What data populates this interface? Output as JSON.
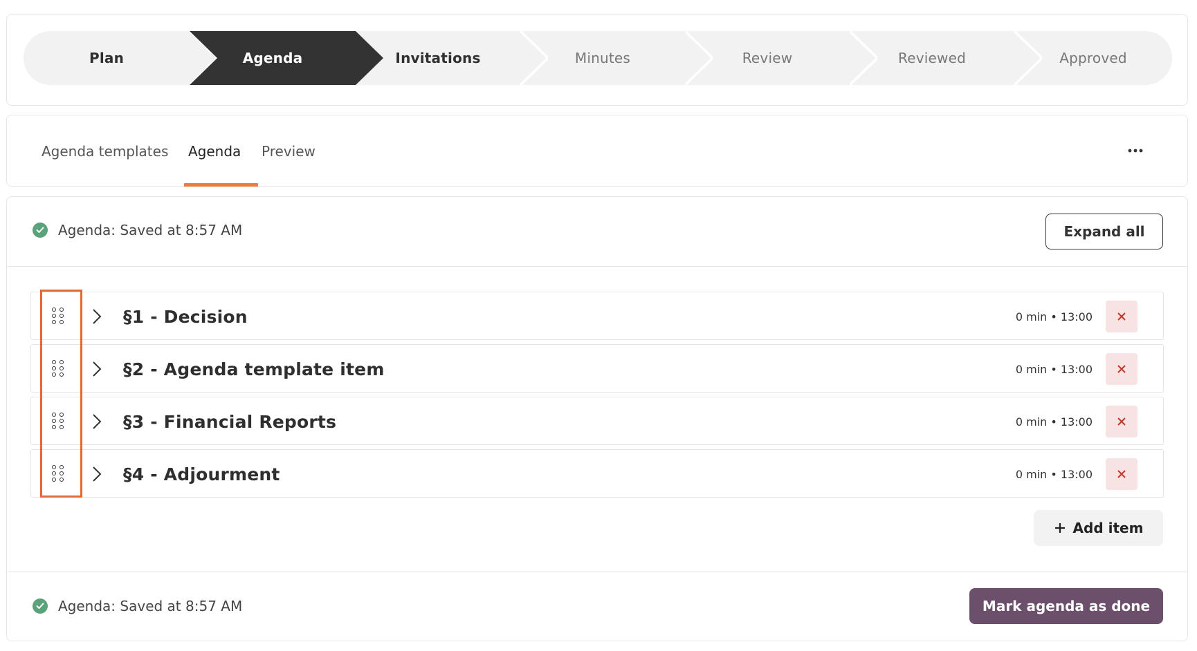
{
  "stepper": {
    "steps": [
      {
        "label": "Plan",
        "state": "done"
      },
      {
        "label": "Agenda",
        "state": "active"
      },
      {
        "label": "Invitations",
        "state": "next"
      },
      {
        "label": "Minutes",
        "state": "future"
      },
      {
        "label": "Review",
        "state": "future"
      },
      {
        "label": "Reviewed",
        "state": "future"
      },
      {
        "label": "Approved",
        "state": "future"
      }
    ]
  },
  "tabs": {
    "items": [
      {
        "label": "Agenda templates"
      },
      {
        "label": "Agenda"
      },
      {
        "label": "Preview"
      }
    ],
    "active": "Agenda",
    "more_icon": "more-horizontal-icon"
  },
  "status": {
    "top": "Agenda: Saved at 8:57 AM",
    "bottom": "Agenda: Saved at 8:57 AM",
    "icon": "check-circle-icon"
  },
  "actions": {
    "expand_all": "Expand all",
    "add_item": "Add item",
    "mark_done": "Mark agenda as done"
  },
  "agenda_items": [
    {
      "title": "§1 - Decision",
      "meta": "0 min • 13:00"
    },
    {
      "title": "§2 - Agenda template item",
      "meta": "0 min • 13:00"
    },
    {
      "title": "§3 - Financial Reports",
      "meta": "0 min • 13:00"
    },
    {
      "title": "§4 - Adjourment",
      "meta": "0 min • 13:00"
    }
  ],
  "colors": {
    "accent": "#ee7b42",
    "active_step": "#333333",
    "primary_button": "#6b4f6b",
    "success": "#5aa37a",
    "delete_bg": "#f8e3e4",
    "delete_icon": "#c0392b",
    "highlight": "#e8692f"
  }
}
